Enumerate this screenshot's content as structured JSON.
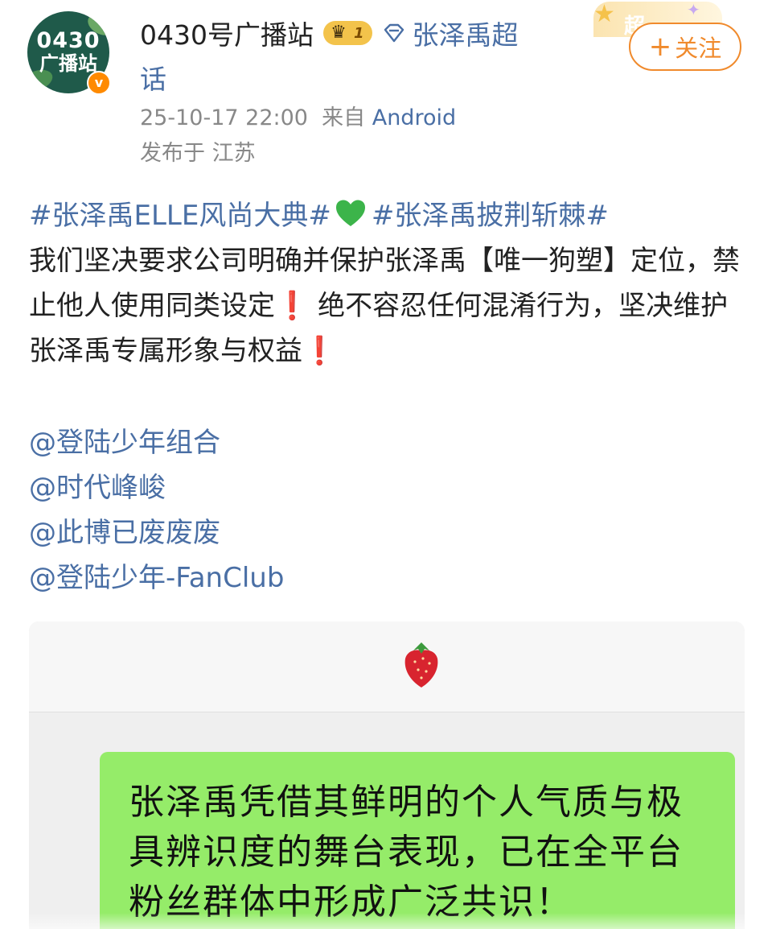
{
  "post": {
    "author": {
      "avatar_line1": "0430",
      "avatar_line2": "广播站",
      "name": "0430号广播站",
      "badge_level": "1"
    },
    "topic_part1": "张泽禹超",
    "topic_part2": "话",
    "super_deco_text": "超",
    "timestamp": "25-10-17 22:00",
    "source_prefix": "来自",
    "source": "Android",
    "location": "发布于 江苏",
    "follow_label": "关注",
    "follow_plus": "+",
    "hashtag1": "#张泽禹ELLE风尚大典#",
    "hashtag2": "#张泽禹披荆斩棘#",
    "body_part1": "我们坚决要求公司明确并保护张泽禹【唯一狗塑】定位，禁止他人使用同类设定",
    "body_excl1": "❗",
    "body_part2": "绝不容忍任何混淆行为，坚决维护张泽禹专属形象与权益",
    "body_excl2": "❗",
    "mentions": [
      "@登陆少年组合",
      "@时代峰峻",
      "@此博已废废废",
      "@登陆少年-FanClub"
    ],
    "image_text": "张泽禹凭借其鲜明的个人气质与极具辨识度的舞台表现，已在全平台粉丝群体中形成广泛共识！"
  },
  "colors": {
    "link": "#4a6fa5",
    "follow": "#f08a2c",
    "chat_bubble": "#95ec69",
    "exclamation": "#d9251a"
  },
  "icons": [
    "verified-icon",
    "crown-icon",
    "diamond-icon",
    "green-heart-icon",
    "exclamation-icon",
    "strawberry-icon"
  ]
}
